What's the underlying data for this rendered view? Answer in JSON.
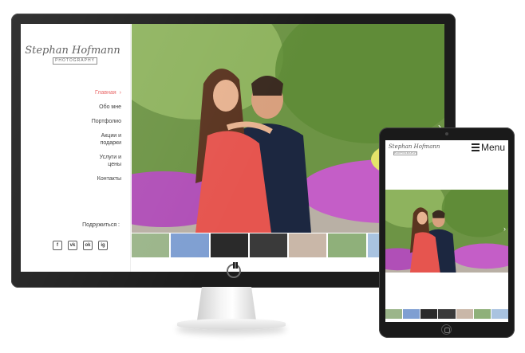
{
  "desktop": {
    "logo": {
      "script": "Stephan Hofmann",
      "sub": "PHOTOGRAPHY"
    },
    "nav": [
      {
        "label": "Главная",
        "active": true
      },
      {
        "label": "Обо мне"
      },
      {
        "label": "Портфолио"
      },
      {
        "label1": "Акции и",
        "label2": "подарки"
      },
      {
        "label1": "Услуги и",
        "label2": "цены"
      },
      {
        "label": "Контакты"
      }
    ],
    "share_label": "Подружиться :",
    "social": [
      "f",
      "vk",
      "ok",
      "ig"
    ],
    "social_icons": [
      "facebook-icon",
      "vk-icon",
      "odnoklassniki-icon",
      "instagram-icon"
    ],
    "hero_next": "›",
    "thumb_colors": [
      "#9bb58a",
      "#7f9fd2",
      "#2a2a2a",
      "#3a3a3a",
      "#c9b7a8",
      "#8fb07a",
      "#a9c3e0",
      "#e8e0d8"
    ]
  },
  "tablet": {
    "logo": {
      "script": "Stephan Hofmann",
      "sub": "PHOTOGRAPHY"
    },
    "menu_label": "Menu",
    "hero_next": "›",
    "thumb_colors": [
      "#9bb58a",
      "#7f9fd2",
      "#2a2a2a",
      "#3a3a3a",
      "#c9b7a8",
      "#8fb07a",
      "#a9c3e0"
    ]
  },
  "colors": {
    "accent": "#e75b5b",
    "frame": "#1c1c1c"
  }
}
